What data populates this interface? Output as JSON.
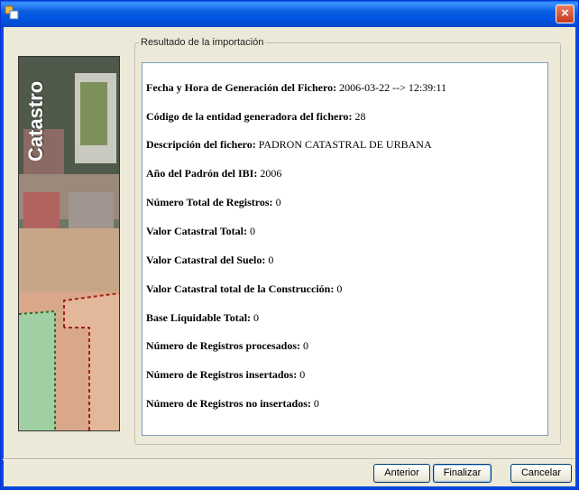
{
  "window": {
    "title": "",
    "close_glyph": "×",
    "app_icon": "app-icon"
  },
  "sidebar": {
    "image_text": "Catastro"
  },
  "group": {
    "label": "Resultado de la importación"
  },
  "results": [
    {
      "label": "Fecha y Hora de Generación del Fichero:",
      "value": "2006-03-22 --> 12:39:11"
    },
    {
      "label": "Código de la entidad generadora del fichero:",
      "value": "28"
    },
    {
      "label": "Descripción del fichero:",
      "value": "PADRON CATASTRAL DE URBANA"
    },
    {
      "label": "Año del Padrón del IBI:",
      "value": "2006"
    },
    {
      "label": "Número Total de Registros:",
      "value": "0"
    },
    {
      "label": "Valor Catastral Total:",
      "value": "0"
    },
    {
      "label": "Valor Catastral del Suelo:",
      "value": "0"
    },
    {
      "label": "Valor Catastral total de la Construcción:",
      "value": "0"
    },
    {
      "label": "Base Liquidable Total:",
      "value": "0"
    },
    {
      "label": "Número de Registros procesados:",
      "value": "0"
    },
    {
      "label": "Número de Registros insertados:",
      "value": "0"
    },
    {
      "label": "Número de Registros no insertados:",
      "value": "0"
    }
  ],
  "buttons": {
    "back": "Anterior",
    "finish": "Finalizar",
    "cancel": "Cancelar"
  }
}
